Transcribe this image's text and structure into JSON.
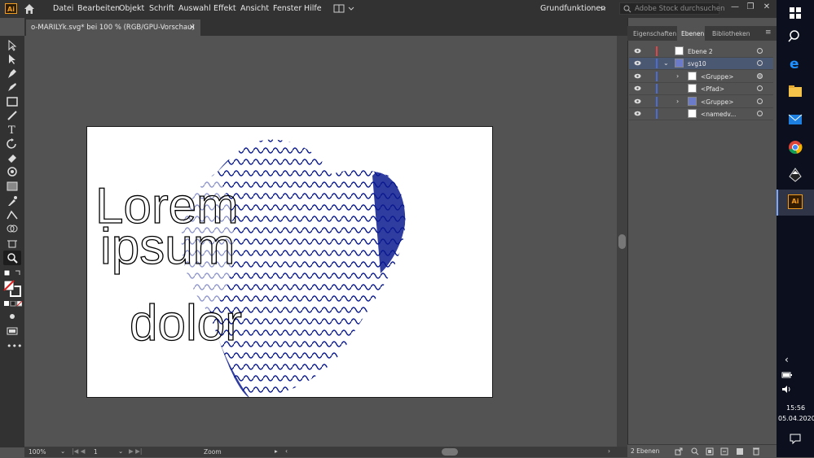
{
  "app": {
    "logo": "Ai"
  },
  "menu": [
    "Datei",
    "Bearbeiten",
    "Objekt",
    "Schrift",
    "Auswahl",
    "Effekt",
    "Ansicht",
    "Fenster",
    "Hilfe"
  ],
  "workspace": "Grundfunktionen",
  "search": {
    "placeholder": "Adobe Stock durchsuchen"
  },
  "document": {
    "tab_title": "o-MARILYk.svg* bei 100 % (RGB/GPU-Vorschau)",
    "close": "×"
  },
  "artwork": {
    "line1": "Lorem",
    "line2": "ipsum",
    "line3": "dolor",
    "wave_color": "#0a1a8f"
  },
  "panel": {
    "tabs": [
      "Eigenschaften",
      "Ebenen",
      "Bibliotheken"
    ],
    "active_tab": "Ebenen",
    "layers": [
      {
        "name": "Ebene 2",
        "color": "#e0454a",
        "indent": 0
      },
      {
        "name": "svg10",
        "color": "#4a6cd4",
        "indent": 0
      },
      {
        "name": "<Gruppe>",
        "color": "#4a6cd4",
        "indent": 1
      },
      {
        "name": "<Pfad>",
        "color": "#4a6cd4",
        "indent": 1
      },
      {
        "name": "<Gruppe>",
        "color": "#4a6cd4",
        "indent": 1
      },
      {
        "name": "<namedv...",
        "color": "#4a6cd4",
        "indent": 1
      }
    ],
    "footer_count": "2 Ebenen"
  },
  "status": {
    "zoom": "100%",
    "page": "1",
    "mode": "Zoom"
  },
  "clock": {
    "time": "15:56",
    "date": "05.04.2020"
  }
}
